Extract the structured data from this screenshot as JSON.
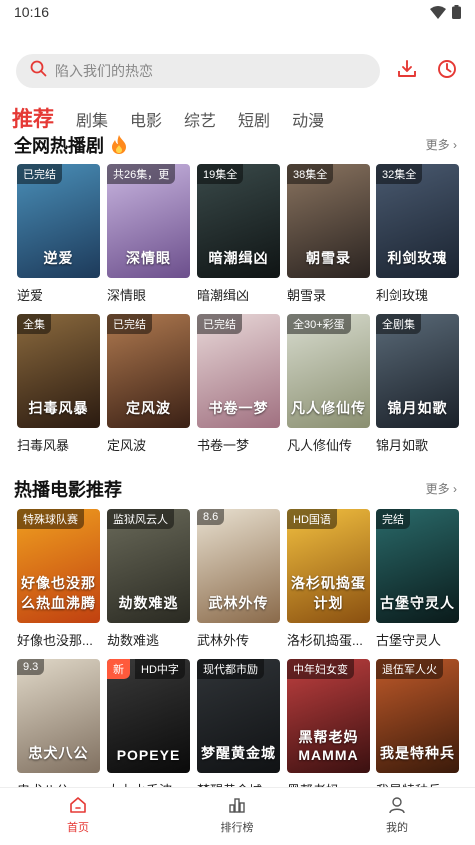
{
  "status": {
    "time": "10:16"
  },
  "search": {
    "placeholder": "陷入我们的热恋"
  },
  "tabs": [
    "推荐",
    "剧集",
    "电影",
    "综艺",
    "短剧",
    "动漫"
  ],
  "sections": [
    {
      "title": "全网热播剧",
      "title_icon": "fire-icon",
      "more": "更多",
      "rows": [
        [
          {
            "badge": "已完结",
            "title": "逆爱",
            "art": "逆爱",
            "colors": [
              "#4a8fb8",
              "#1d3a5a"
            ]
          },
          {
            "badge": "共26集，更",
            "title": "深情眼",
            "art": "深情眼",
            "colors": [
              "#c9b6e0",
              "#6c4f8c"
            ]
          },
          {
            "badge": "19集全",
            "title": "暗潮缉凶",
            "art": "暗潮缉凶",
            "colors": [
              "#3a4a4a",
              "#0f1414"
            ]
          },
          {
            "badge": "38集全",
            "title": "朝雪录",
            "art": "朝雪录",
            "colors": [
              "#8a7460",
              "#2a2320"
            ]
          },
          {
            "badge": "32集全",
            "title": "利剑玫瑰",
            "art": "利剑玫瑰",
            "colors": [
              "#4a5a70",
              "#1a2330"
            ]
          }
        ],
        [
          {
            "badge": "全集",
            "title": "扫毒风暴",
            "art": "扫毒风暴",
            "colors": [
              "#8b6a3e",
              "#2a1a10"
            ]
          },
          {
            "badge": "已完结",
            "title": "定风波",
            "art": "定风波",
            "colors": [
              "#b07a50",
              "#3a2015"
            ]
          },
          {
            "badge": "已完结",
            "title": "书卷一梦",
            "art": "书卷一梦",
            "colors": [
              "#e8d8d8",
              "#a07080"
            ]
          },
          {
            "badge": "全30+彩蛋",
            "title": "凡人修仙传",
            "art": "凡人修仙传",
            "colors": [
              "#d8dccf",
              "#8a8f70"
            ]
          },
          {
            "badge": "全剧集",
            "title": "锦月如歌",
            "art": "锦月如歌",
            "colors": [
              "#5a6a78",
              "#1a2028"
            ]
          }
        ]
      ]
    },
    {
      "title": "热播电影推荐",
      "more": "更多",
      "rows": [
        [
          {
            "badge": "特殊球队赛",
            "title": "好像也没那...",
            "art": "好像也没那么热血沸腾",
            "colors": [
              "#f0a020",
              "#c04010"
            ]
          },
          {
            "badge": "监狱风云人",
            "title": "劫数难逃",
            "art": "劫数难逃",
            "colors": [
              "#6a6a5a",
              "#2a2a22"
            ]
          },
          {
            "badge": "8.6",
            "title": "武林外传",
            "art": "武林外传",
            "colors": [
              "#e8e0d0",
              "#8a6a4a"
            ]
          },
          {
            "badge": "HD国语",
            "title": "洛杉矶捣蛋...",
            "art": "洛杉矶捣蛋计划",
            "colors": [
              "#f2c040",
              "#8a5010"
            ]
          },
          {
            "badge": "完结",
            "title": "古堡守灵人",
            "art": "古堡守灵人",
            "colors": [
              "#2a6a6a",
              "#0a1a1a"
            ]
          }
        ],
        [
          {
            "badge": "9.3",
            "title": "忠犬八公",
            "art": "忠犬八公",
            "colors": [
              "#e0d8c8",
              "#807060"
            ]
          },
          {
            "badge": "HD中字",
            "badge_new": "新",
            "title": "大力水手波...",
            "art": "POPEYE",
            "colors": [
              "#3a3a3a",
              "#0a0a0a"
            ]
          },
          {
            "badge": "现代都市励",
            "title": "梦醒黄金城",
            "art": "梦醒黄金城",
            "colors": [
              "#303438",
              "#101214"
            ]
          },
          {
            "badge": "中年妇女变",
            "title": "黑帮老妈",
            "art": "黑帮老妈 MAMMA",
            "colors": [
              "#c04040",
              "#3a1010"
            ]
          },
          {
            "badge": "退伍军人火",
            "title": "我是特种兵...",
            "art": "我是特种兵",
            "colors": [
              "#c05a2a",
              "#3a1a0a"
            ]
          }
        ]
      ]
    }
  ],
  "bottom_nav": [
    {
      "label": "首页",
      "icon": "home-icon",
      "active": true
    },
    {
      "label": "排行榜",
      "icon": "chart-bars-icon",
      "active": false
    },
    {
      "label": "我的",
      "icon": "user-icon",
      "active": false
    }
  ],
  "accent": "#e53935"
}
